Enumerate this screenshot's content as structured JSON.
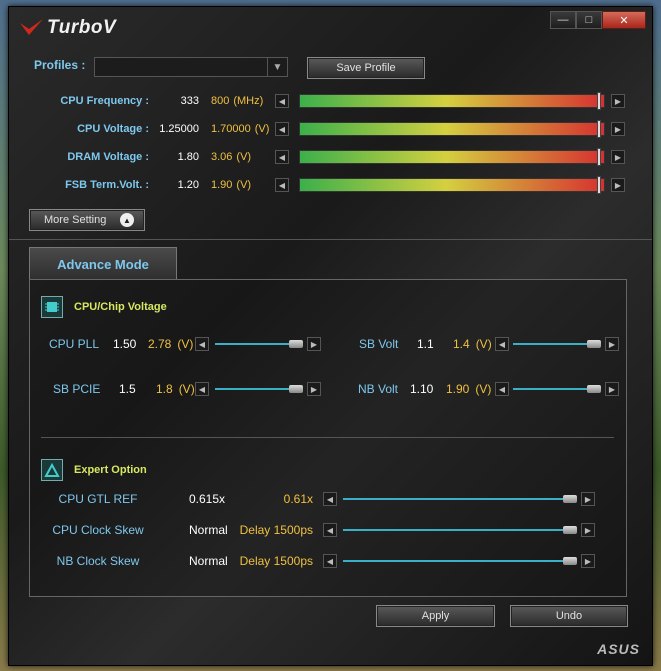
{
  "title": "TurboV",
  "window_buttons": {
    "minimize": "—",
    "maximize": "□",
    "close": "✕"
  },
  "profiles": {
    "label": "Profiles :",
    "value": "",
    "save_label": "Save Profile"
  },
  "main_rows": [
    {
      "label": "CPU Frequency :",
      "current": "333",
      "target": "800",
      "unit": "(MHz)",
      "level": 0.99
    },
    {
      "label": "CPU Voltage :",
      "current": "1.25000",
      "target": "1.70000",
      "unit": "(V)",
      "level": 0.99
    },
    {
      "label": "DRAM Voltage :",
      "current": "1.80",
      "target": "3.06",
      "unit": "(V)",
      "level": 0.99
    },
    {
      "label": "FSB Term.Volt. :",
      "current": "1.20",
      "target": "1.90",
      "unit": "(V)",
      "level": 0.99
    }
  ],
  "more_setting_label": "More Setting",
  "advance_tab_label": "Advance Mode",
  "cpu_chip": {
    "title": "CPU/Chip Voltage",
    "items": [
      {
        "label": "CPU PLL",
        "current": "1.50",
        "target": "2.78",
        "unit": "(V)"
      },
      {
        "label": "SB Volt",
        "current": "1.1",
        "target": "1.4",
        "unit": "(V)"
      },
      {
        "label": "SB PCIE",
        "current": "1.5",
        "target": "1.8",
        "unit": "(V)"
      },
      {
        "label": "NB Volt",
        "current": "1.10",
        "target": "1.90",
        "unit": "(V)"
      }
    ]
  },
  "expert": {
    "title": "Expert Option",
    "items": [
      {
        "label": "CPU GTL REF",
        "current": "0.615x",
        "target": "0.61x"
      },
      {
        "label": "CPU Clock Skew",
        "current": "Normal",
        "target": "Delay 1500ps"
      },
      {
        "label": "NB Clock Skew",
        "current": "Normal",
        "target": "Delay 1500ps"
      }
    ]
  },
  "apply_label": "Apply",
  "undo_label": "Undo",
  "brand": "ASUS",
  "colors": {
    "accent_blue": "#7ec8ee",
    "value_yellow": "#f0c040",
    "section_title": "#d8e860",
    "close_red": "#c43c2c"
  },
  "icons": {
    "logo": "turbov-logo-icon",
    "chip": "chip-icon",
    "expert": "expert-icon",
    "more": "chevron-up-icon"
  }
}
